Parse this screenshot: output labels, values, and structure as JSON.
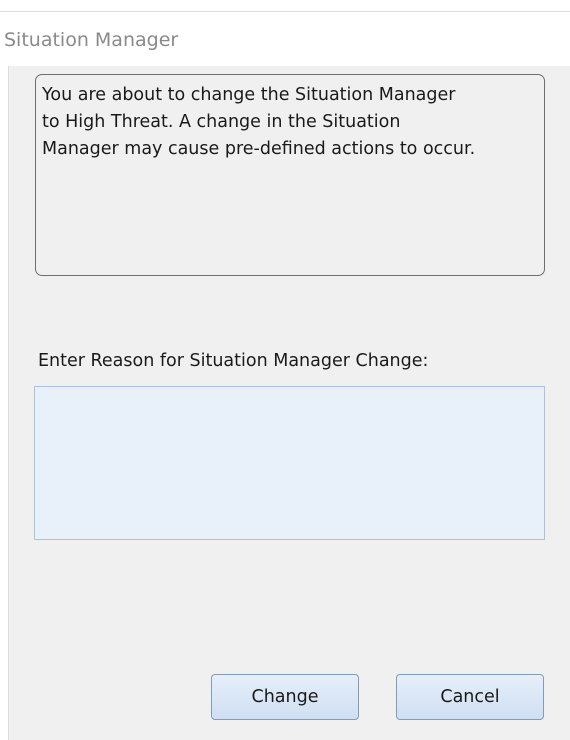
{
  "window": {
    "title": "Situation Manager"
  },
  "message": {
    "line1": "You are about to change the Situation Manager",
    "line2": "to High Threat.  A change in the Situation",
    "line3": "Manager may cause pre-defined actions to occur."
  },
  "reason": {
    "label": "Enter Reason for Situation Manager Change:",
    "value": "",
    "placeholder": ""
  },
  "buttons": {
    "change_label": "Change",
    "cancel_label": "Cancel"
  },
  "colors": {
    "client_background": "#f0f0f0",
    "input_background": "#e8f0f9",
    "input_border": "#a9c3e0",
    "button_border": "#7f9db9",
    "title_text": "#8a8a8a"
  }
}
